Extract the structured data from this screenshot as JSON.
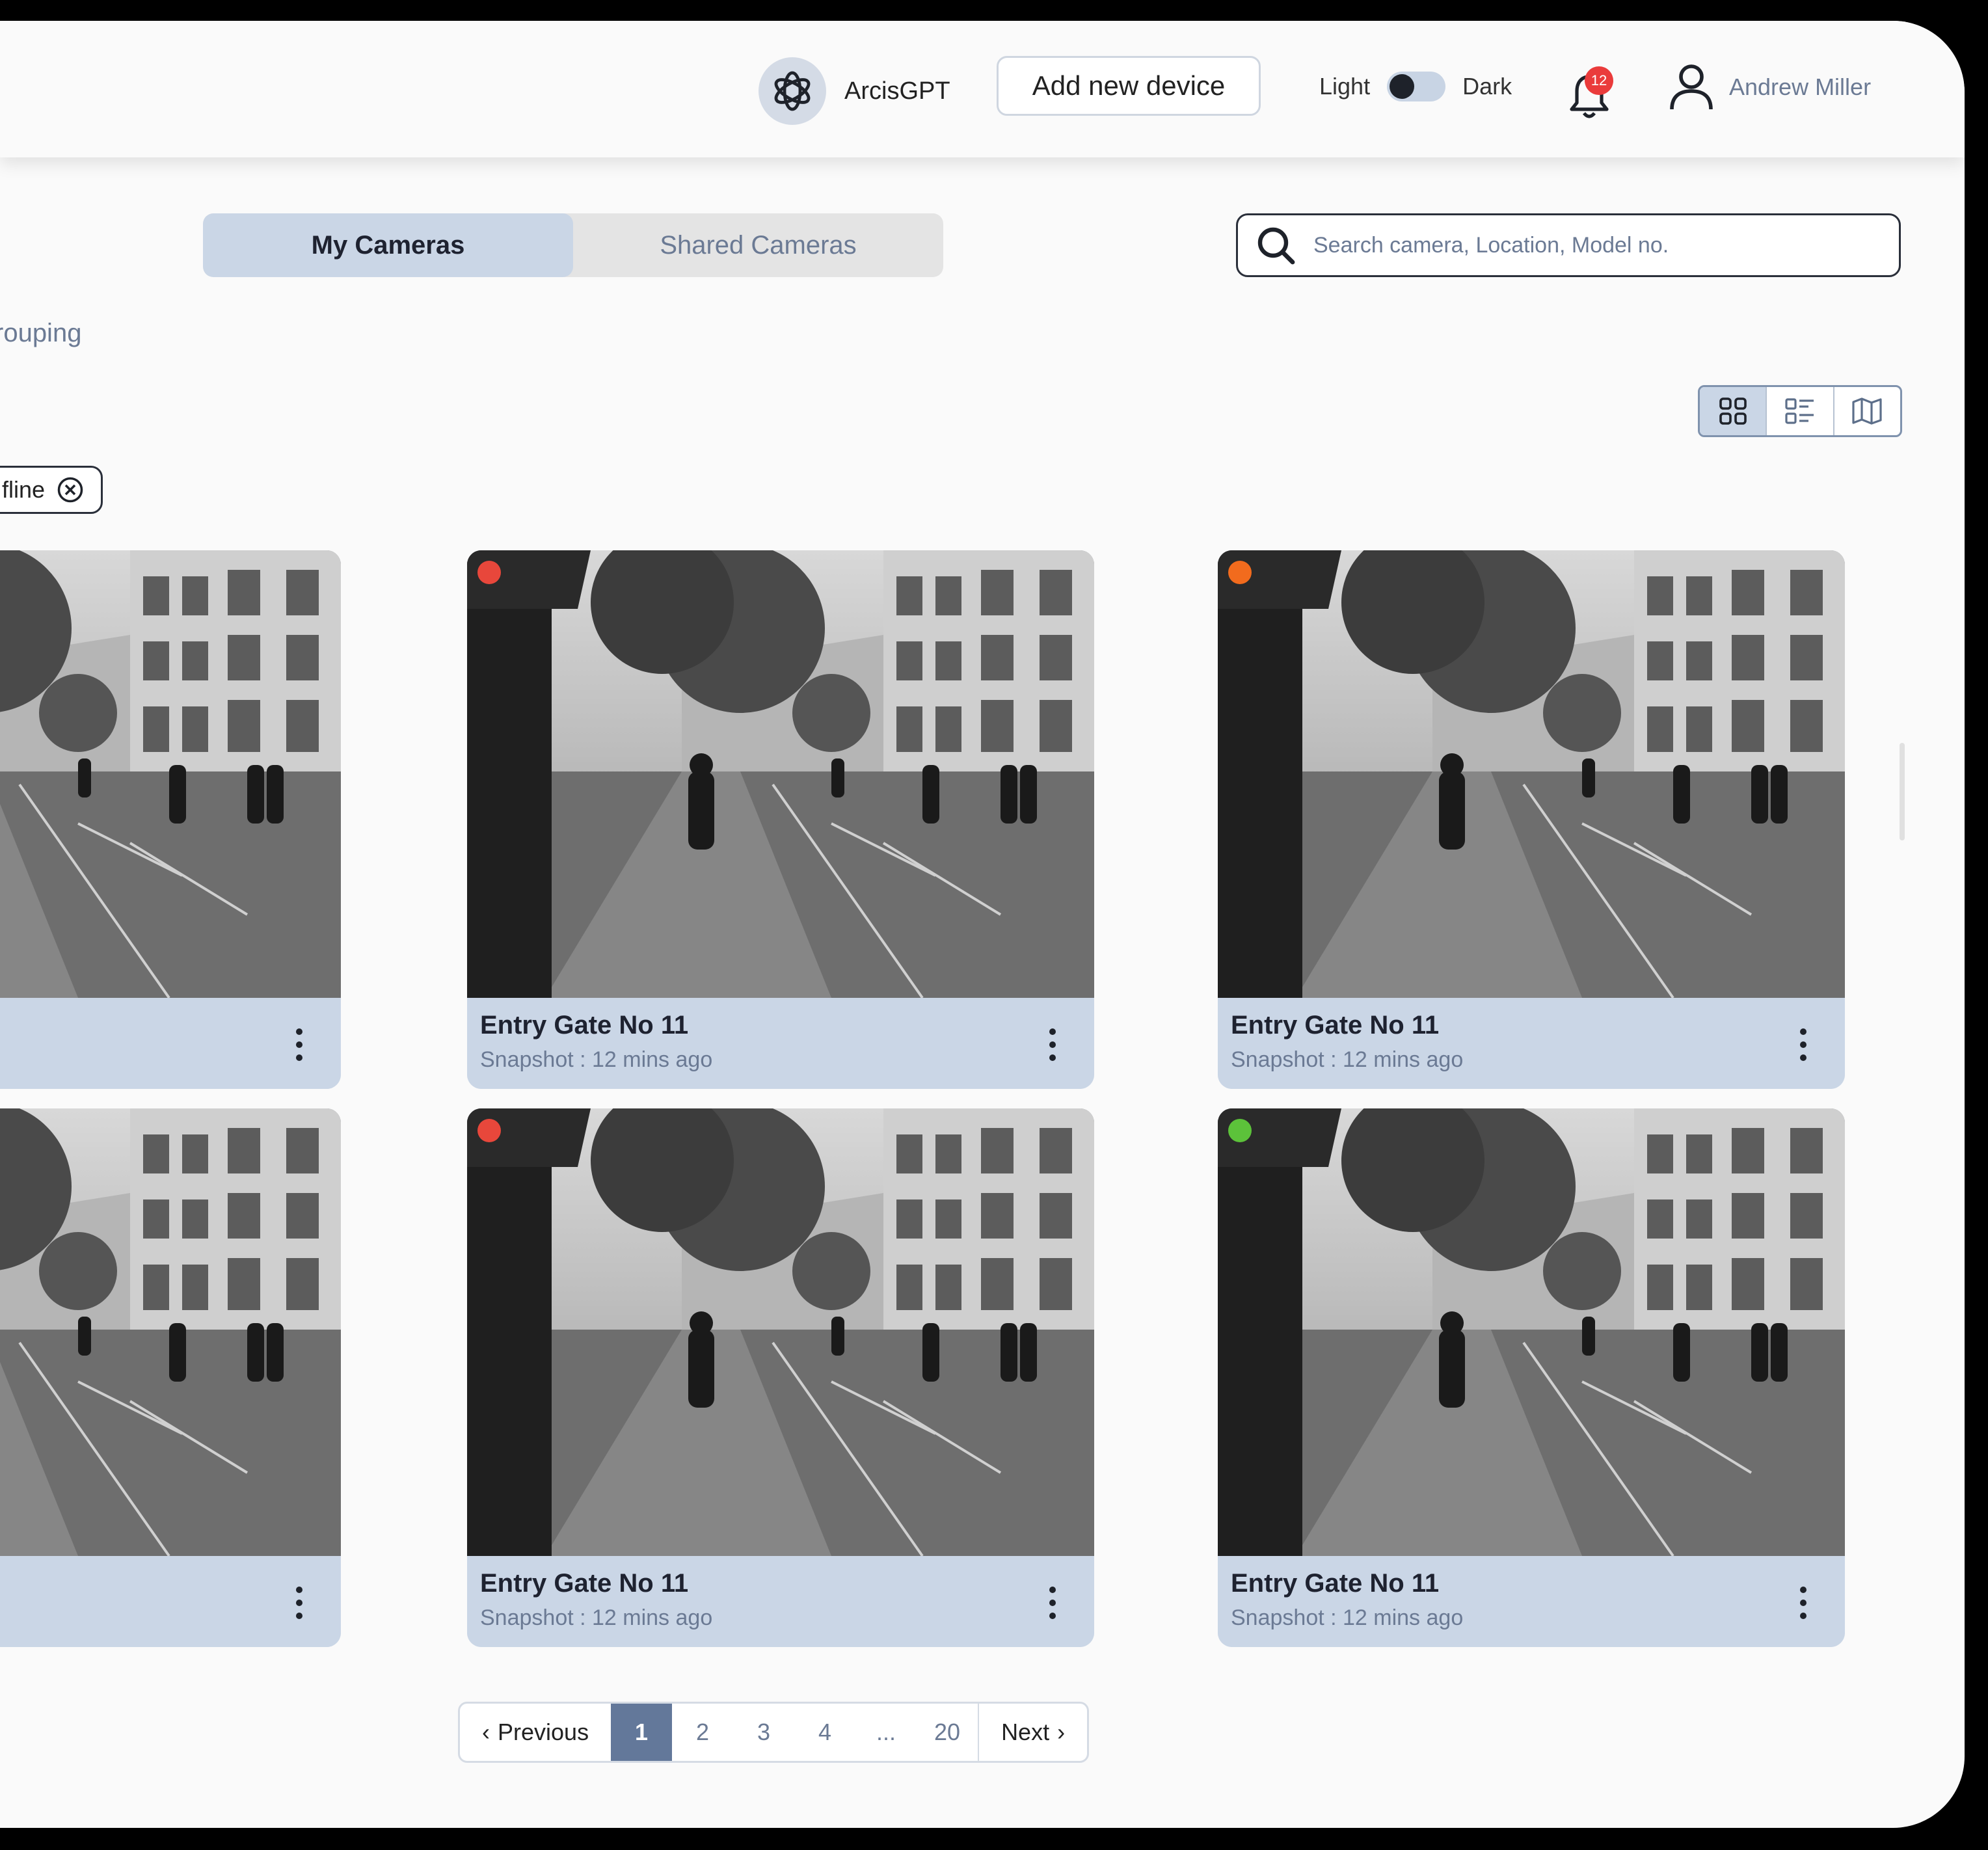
{
  "header": {
    "brand_name": "ArcisGPT",
    "brand_icon": "openai-logo-icon",
    "add_device_label": "Add new device",
    "theme_light_label": "Light",
    "theme_dark_label": "Dark",
    "notification_count": "12",
    "user_name": "Andrew Miller"
  },
  "tabs": [
    {
      "label": "My Cameras",
      "active": true
    },
    {
      "label": "Shared Cameras",
      "active": false
    }
  ],
  "search": {
    "placeholder": "Search camera, Location, Model no."
  },
  "sidebar": {
    "grouping_label": "rouping",
    "filter_chip_label": "fline"
  },
  "view_modes": [
    "grid-view-icon",
    "list-view-icon",
    "map-view-icon"
  ],
  "colors": {
    "accent": "#cad6e6",
    "status_red": "#e8473b",
    "status_orange": "#f26b1d",
    "status_green": "#5cc23a",
    "page_active": "#63789a"
  },
  "cameras": [
    {
      "title": "",
      "snapshot": "",
      "status": ""
    },
    {
      "title": "Entry Gate No 11",
      "snapshot": "Snapshot : 12 mins ago",
      "status": "red"
    },
    {
      "title": "Entry Gate No 11",
      "snapshot": "Snapshot : 12 mins ago",
      "status": "orange"
    },
    {
      "title": "",
      "snapshot": "",
      "status": ""
    },
    {
      "title": "Entry Gate No 11",
      "snapshot": "Snapshot : 12 mins ago",
      "status": "red"
    },
    {
      "title": "Entry Gate No 11",
      "snapshot": "Snapshot : 12 mins ago",
      "status": "green"
    }
  ],
  "pagination": {
    "previous_label": "Previous",
    "next_label": "Next",
    "pages": [
      "1",
      "2",
      "3",
      "4",
      "...",
      "20"
    ],
    "current": "1"
  }
}
